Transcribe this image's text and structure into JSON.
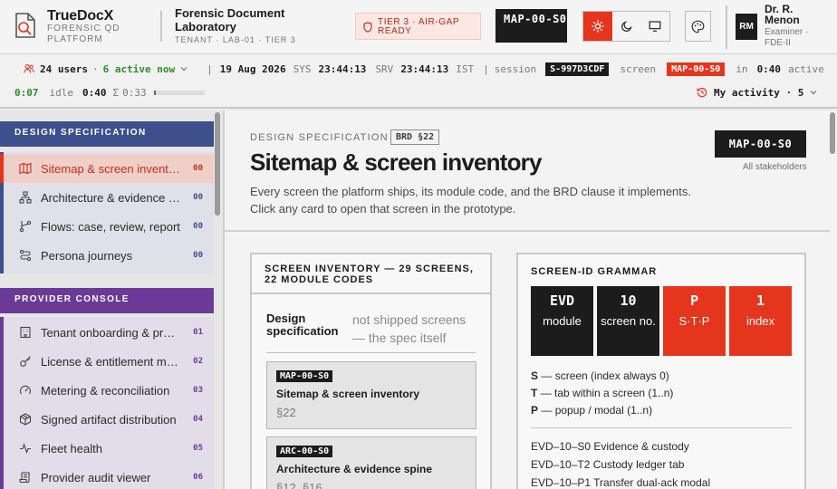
{
  "brand": {
    "name": "TrueDocX",
    "sub": "FORENSIC QD PLATFORM"
  },
  "lab": {
    "title": "Forensic Document Laboratory",
    "sub": "TENANT · LAB-01 · TIER 3"
  },
  "tier_badge": "TIER 3 · AIR-GAP READY",
  "screen_code": "MAP-00-S0",
  "user": {
    "initials": "RM",
    "name": "Dr. R. Menon",
    "role": "Examiner · FDE-II"
  },
  "status": {
    "users": "24 users",
    "active": "6 active now",
    "date": "19 Aug 2026",
    "sys_label": "SYS",
    "sys_time": "23:44:13",
    "srv_label": "SRV",
    "srv_time": "23:44:13",
    "tz": "IST",
    "session_label": "session",
    "session_code": "S-997D3CDF",
    "screen_label": "screen",
    "screen_code": "MAP-00-S0",
    "in_label": "in",
    "in_time": "0:40",
    "active_label": "active",
    "active_time": "0:07",
    "idle_label": "idle",
    "idle_time": "0:40",
    "sum_label": "Σ",
    "sum_time": "0:33",
    "progress_fraction": 0.04,
    "my_activity": "My activity · 5",
    "colors": {
      "accent": "#e6351d",
      "green": "#2f8a2f"
    }
  },
  "sidebar": {
    "design": {
      "title": "DESIGN SPECIFICATION",
      "color": "#3d4f8c",
      "items": [
        {
          "label": "Sitemap & screen inventory",
          "num": "00",
          "icon": "map-icon",
          "active": true
        },
        {
          "label": "Architecture & evidence spine",
          "num": "00",
          "icon": "hierarchy-icon"
        },
        {
          "label": "Flows: case, review, report",
          "num": "00",
          "icon": "git-branch-icon"
        },
        {
          "label": "Persona journeys",
          "num": "00",
          "icon": "route-icon"
        }
      ]
    },
    "provider": {
      "title": "PROVIDER CONSOLE",
      "color": "#6b3a96",
      "items": [
        {
          "label": "Tenant onboarding & provisioning",
          "num": "01",
          "icon": "building-icon"
        },
        {
          "label": "License & entitlement management",
          "num": "02",
          "icon": "key-icon"
        },
        {
          "label": "Metering & reconciliation",
          "num": "03",
          "icon": "gauge-icon"
        },
        {
          "label": "Signed artifact distribution",
          "num": "04",
          "icon": "package-icon"
        },
        {
          "label": "Fleet health",
          "num": "05",
          "icon": "activity-icon"
        },
        {
          "label": "Provider audit viewer",
          "num": "06",
          "icon": "scroll-icon"
        }
      ]
    }
  },
  "main": {
    "eyebrow": "DESIGN SPECIFICATION",
    "brd": "BRD §22",
    "title": "Sitemap & screen inventory",
    "desc": "Every screen the platform ships, its module code, and the BRD clause it implements. Click any card to open that screen in the prototype.",
    "screen_code": "MAP-00-S0",
    "audience": "All stakeholders"
  },
  "inventory": {
    "title": "SCREEN INVENTORY — 29 SCREENS, 22 MODULE CODES",
    "group_label": "Design specification",
    "group_note": "not shipped screens — the spec itself",
    "cards": [
      {
        "code": "MAP-00-S0",
        "name": "Sitemap & screen inventory",
        "clause": "§22"
      },
      {
        "code": "ARC-00-S0",
        "name": "Architecture & evidence spine",
        "clause": "§12, §16"
      }
    ]
  },
  "grammar": {
    "title": "SCREEN-ID GRAMMAR",
    "parts": [
      {
        "top": "EVD",
        "bottom": "module",
        "style": "dark"
      },
      {
        "top": "10",
        "bottom": "screen no.",
        "style": "dark"
      },
      {
        "top": "P",
        "bottom": "S·T·P",
        "style": "red"
      },
      {
        "top": "1",
        "bottom": "index",
        "style": "red"
      }
    ],
    "legend": [
      {
        "key": "S",
        "text": "— screen (index always 0)"
      },
      {
        "key": "T",
        "text": "— tab within a screen (1..n)"
      },
      {
        "key": "P",
        "text": "— popup / modal (1..n)"
      }
    ],
    "examples": [
      "EVD–10–S0 Evidence & custody",
      "EVD–10–T2 Custody ledger tab",
      "EVD–10–P1 Transfer dual-ack modal"
    ]
  }
}
